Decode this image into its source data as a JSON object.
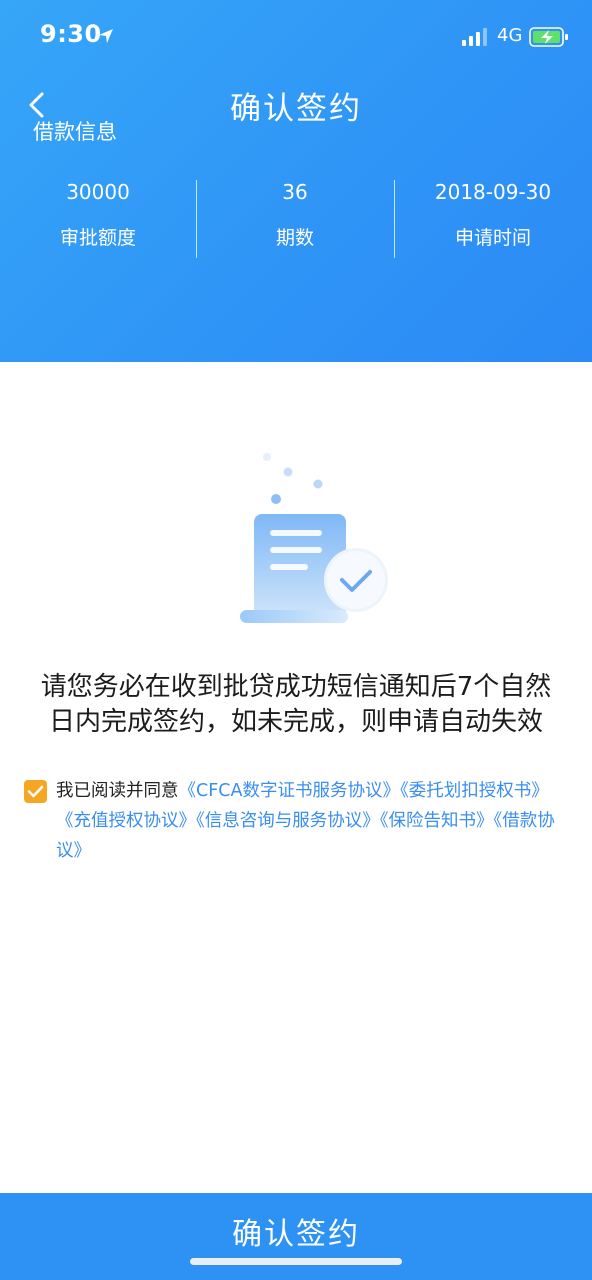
{
  "status_bar": {
    "time": "9:30",
    "network": "4G"
  },
  "header": {
    "title": "确认签约",
    "section_label": "借款信息"
  },
  "stats": [
    {
      "value": "30000",
      "label": "审批额度"
    },
    {
      "value": "36",
      "label": "期数"
    },
    {
      "value": "2018-09-30",
      "label": "申请时间"
    }
  ],
  "notice": {
    "line1": "请您务必在收到批贷成功短信通知后7个自然",
    "line2": "日内完成签约，如未完成，则申请自动失效"
  },
  "agreement": {
    "checked": true,
    "prefix": "我已阅读并同意",
    "links": [
      "《CFCA数字证书服务协议》",
      "《委托划扣授权书》",
      "《充值授权协议》",
      "《信息咨询与服务协议》",
      "《保险告知书》",
      "《借款协议》"
    ]
  },
  "footer": {
    "confirm_label": "确认签约"
  },
  "colors": {
    "primary": "#2d92f3",
    "checkbox": "#f5a623",
    "link": "#3a8ef0"
  },
  "icons": [
    "location-arrow-icon",
    "signal-bars-icon",
    "battery-charging-icon",
    "back-chevron-icon",
    "document-check-illustration",
    "checkmark-icon"
  ]
}
